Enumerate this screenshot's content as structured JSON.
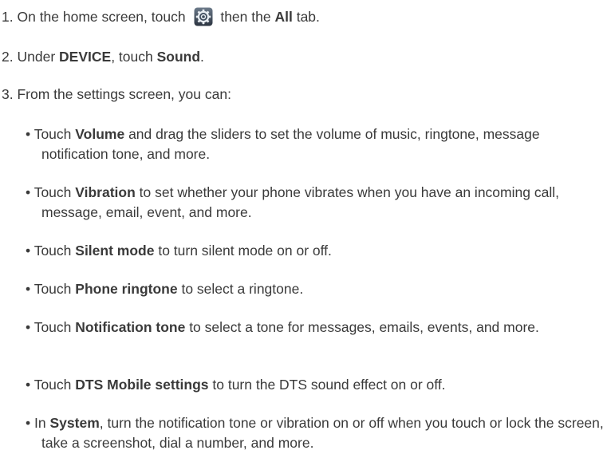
{
  "steps": [
    {
      "number": "1.",
      "before_icon": "On the home screen, touch",
      "icon": "settings-gear-icon",
      "after_icon": "then the",
      "bold": "All",
      "tail": "tab."
    },
    {
      "number": "2.",
      "text1": "Under",
      "bold1": "DEVICE",
      "text2": ", touch",
      "bold2": "Sound",
      "tail": "."
    },
    {
      "number": "3.",
      "text": "From the settings screen, you can:"
    }
  ],
  "bullets": [
    {
      "mark": "•",
      "lead": "Touch",
      "bold": "Volume",
      "text": "and drag the sliders to set the volume of music, ringtone, message notification tone, and more."
    },
    {
      "mark": "•",
      "lead": "Touch",
      "bold": "Vibration",
      "text": "to set whether your phone vibrates when you have an incoming call, message, email, event, and more."
    },
    {
      "mark": "•",
      "lead": "Touch",
      "bold": "Silent mode",
      "text": "to turn silent mode on or off."
    },
    {
      "mark": "•",
      "lead": "Touch",
      "bold": "Phone ringtone",
      "text": "to select a ringtone."
    },
    {
      "mark": "•",
      "lead": "Touch",
      "bold": "Notification tone",
      "text": "to select a tone for messages, emails, events, and more."
    },
    {
      "mark": "•",
      "lead": "Touch",
      "bold": "DTS Mobile settings",
      "text": "to turn the DTS sound effect on or off."
    },
    {
      "mark": "•",
      "lead": "In",
      "bold": "System",
      "text": ", turn the notification tone or vibration on or off when you touch or lock the screen, take a screenshot, dial a number, and more."
    }
  ],
  "colors": {
    "text": "#3a3a3a",
    "icon_bg": "#3f4c5c",
    "icon_fg": "#e8edf2"
  }
}
